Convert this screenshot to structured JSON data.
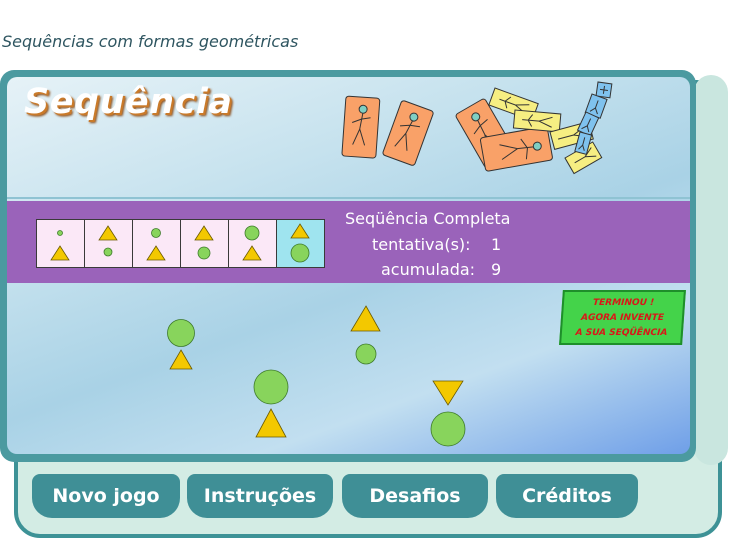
{
  "page": {
    "caption": "Sequências com formas geométricas"
  },
  "game": {
    "title": "Sequência",
    "status": {
      "label": "Seqüência  Completa"
    },
    "attempts": {
      "label": "tentativa(s):",
      "value": "1"
    },
    "accumulated": {
      "label": "acumulada:",
      "value": "9"
    },
    "finish_message": [
      "TERMINOU !",
      "AGORA INVENTE",
      "A SUA SEQÜÊNCIA"
    ],
    "sequence": [
      {
        "top": "small-circle",
        "bottom": "triangle"
      },
      {
        "top": "triangle",
        "bottom": "small-circle"
      },
      {
        "top": "small-circle",
        "bottom": "triangle"
      },
      {
        "top": "triangle",
        "bottom": "circle"
      },
      {
        "top": "circle",
        "bottom": "triangle"
      },
      {
        "top": "triangle",
        "bottom": "large-circle",
        "selected": true
      }
    ]
  },
  "footer": {
    "buttons": [
      "Novo jogo",
      "Instruções",
      "Desafios",
      "Créditos"
    ]
  },
  "colors": {
    "triangle": "#f3c800",
    "circle": "#88d45c",
    "band": "#9a63ba",
    "frame": "#4b9aa0",
    "finish_box": "#44d34a",
    "finish_text": "#d81818",
    "orange_card": "#f9a168",
    "yellow_card": "#f6ee82",
    "blue_card": "#7fc2ee"
  }
}
